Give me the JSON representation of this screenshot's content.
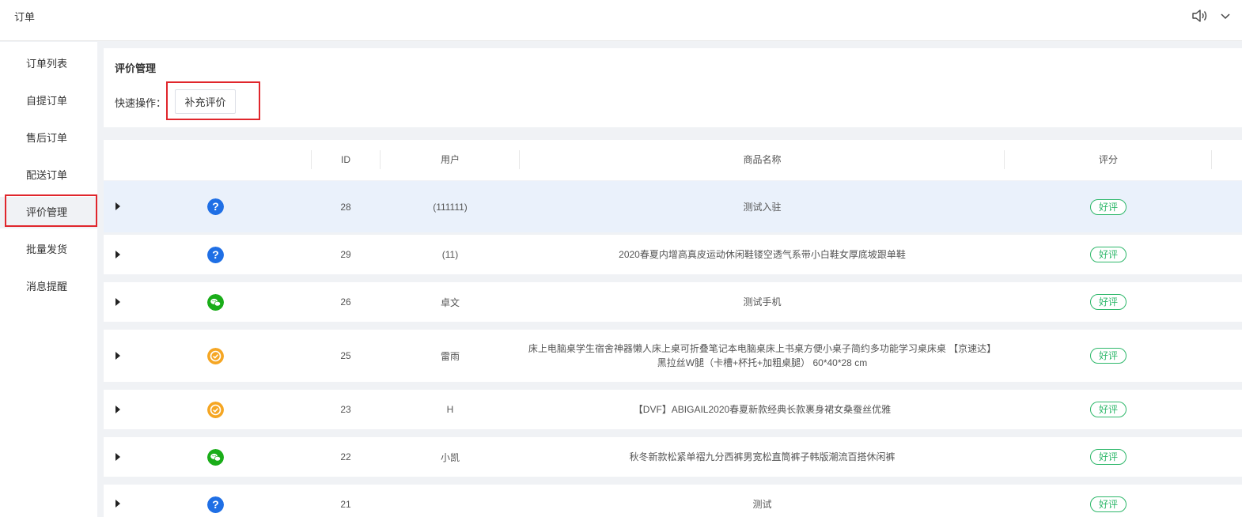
{
  "header": {
    "title": "订单",
    "speaker_icon": "speaker-icon",
    "chevron_icon": "chevron-down-icon"
  },
  "sidebar": {
    "items": [
      {
        "label": "订单列表",
        "active": false
      },
      {
        "label": "自提订单",
        "active": false
      },
      {
        "label": "售后订单",
        "active": false
      },
      {
        "label": "配送订单",
        "active": false
      },
      {
        "label": "评价管理",
        "active": true
      },
      {
        "label": "批量发货",
        "active": false
      },
      {
        "label": "消息提醒",
        "active": false
      }
    ]
  },
  "panel": {
    "title": "评价管理",
    "quick_label": "快速操作：",
    "quick_button": "补充评价"
  },
  "table": {
    "columns": [
      "ID",
      "用户",
      "商品名称",
      "评分"
    ],
    "rows": [
      {
        "icon": "question-icon",
        "id": "28",
        "user": "(111111)",
        "product": "测试入驻",
        "rating": "好评"
      },
      {
        "icon": "question-icon",
        "id": "29",
        "user": "(11)",
        "product": "2020春夏内增高真皮运动休闲鞋镂空透气系带小白鞋女厚底坡跟单鞋",
        "rating": "好评"
      },
      {
        "icon": "wechat-icon",
        "id": "26",
        "user": "卓文",
        "product": "测试手机",
        "rating": "好评"
      },
      {
        "icon": "verified-icon",
        "id": "25",
        "user": "雷雨",
        "product": "床上电脑桌学生宿舍神器懒人床上桌可折叠笔记本电脑桌床上书桌方便小桌子简约多功能学习桌床桌 【京速达】黑拉丝W腿（卡槽+杯托+加粗桌腿） 60*40*28 cm",
        "rating": "好评"
      },
      {
        "icon": "verified-icon",
        "id": "23",
        "user": "H",
        "product": "【DVF】ABIGAIL2020春夏新款经典长款裹身裙女桑蚕丝优雅",
        "rating": "好评"
      },
      {
        "icon": "wechat-icon",
        "id": "22",
        "user": "小凯",
        "product": "秋冬新款松紧单褶九分西裤男宽松直筒裤子韩版潮流百搭休闲裤",
        "rating": "好评"
      },
      {
        "icon": "question-icon",
        "id": "21",
        "user": "",
        "product": "测试",
        "rating": "好评"
      }
    ]
  },
  "colors": {
    "question": "#1f6fe5",
    "wechat": "#1aad19",
    "verified": "#f5a623",
    "badge": "#2fb86b",
    "highlight_box": "#e0262c",
    "selected_row": "#eaf1fb"
  }
}
